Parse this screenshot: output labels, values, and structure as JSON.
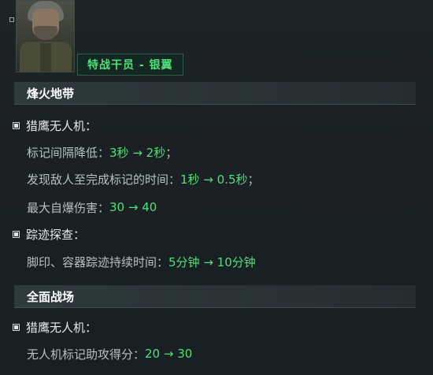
{
  "operator": {
    "name": "特战干员 - 银翼"
  },
  "sections": [
    {
      "title": "烽火地带",
      "groups": [
        {
          "label": "猎鹰无人机：",
          "details": [
            {
              "text": "标记间隔降低：",
              "value": "3秒 → 2秒",
              "suffix": "；"
            },
            {
              "text": "发现敌人至完成标记的时间：",
              "value": "1秒 → 0.5秒",
              "suffix": "；"
            },
            {
              "text": "最大自爆伤害：",
              "value": "30 → 40",
              "suffix": ""
            }
          ]
        },
        {
          "label": "踪迹探查：",
          "details": [
            {
              "text": "脚印、容器踪迹持续时间：",
              "value": "5分钟 → 10分钟",
              "suffix": ""
            }
          ]
        }
      ]
    },
    {
      "title": "全面战场",
      "groups": [
        {
          "label": "猎鹰无人机：",
          "details": [
            {
              "text": "无人机标记助攻得分：",
              "value": "20 → 30",
              "suffix": ""
            }
          ]
        }
      ]
    }
  ],
  "colors": {
    "highlight": "#4ee07a",
    "background": "#1a2023",
    "header": "#2f3a3d"
  }
}
